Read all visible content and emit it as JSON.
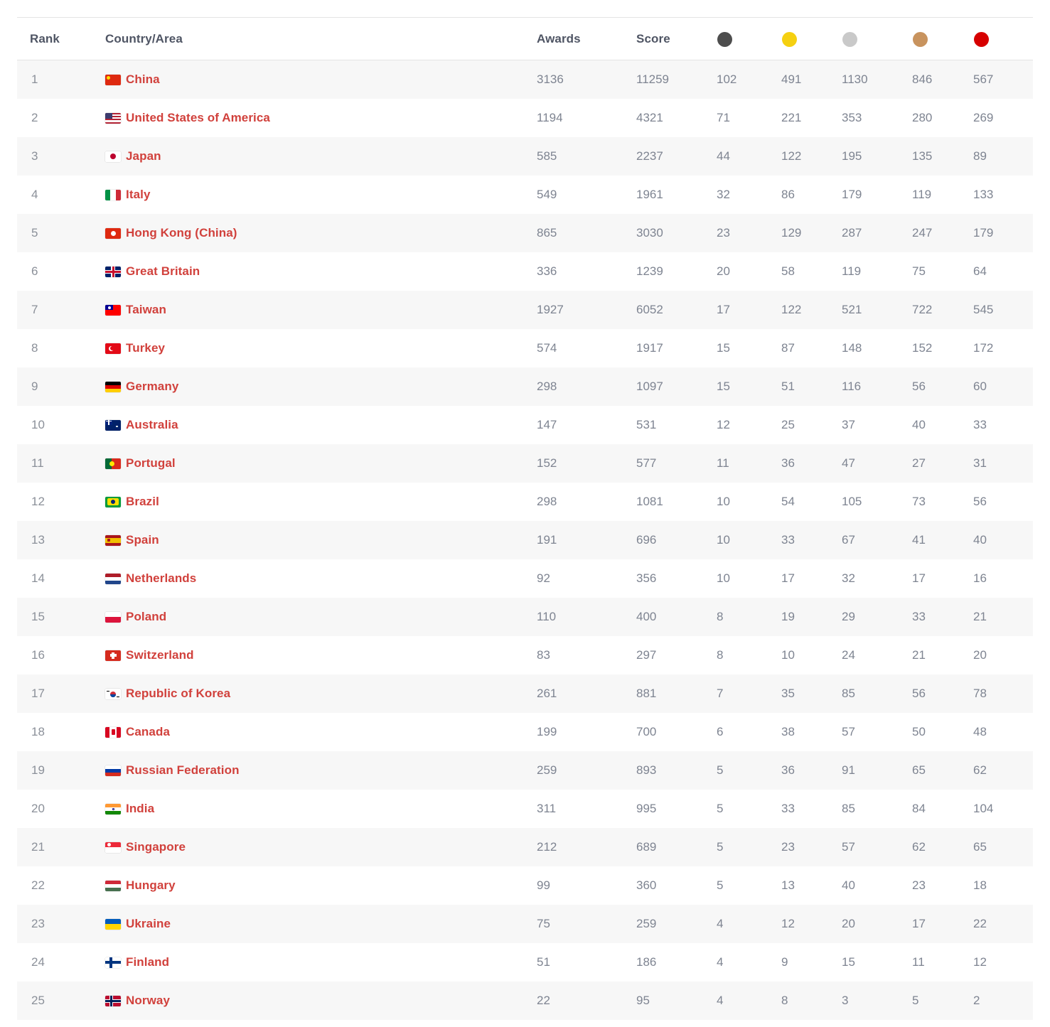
{
  "table": {
    "columns": [
      {
        "key": "rank",
        "label": "Rank",
        "type": "text"
      },
      {
        "key": "country",
        "label": "Country/Area",
        "type": "text"
      },
      {
        "key": "awards",
        "label": "Awards",
        "type": "text"
      },
      {
        "key": "score",
        "label": "Score",
        "type": "text"
      },
      {
        "key": "m1",
        "label": "",
        "type": "dot",
        "icon": "dark-medal-icon",
        "color": "#4d4d4d"
      },
      {
        "key": "m2",
        "label": "",
        "type": "dot",
        "icon": "gold-medal-icon",
        "color": "#f5d011"
      },
      {
        "key": "m3",
        "label": "",
        "type": "dot",
        "icon": "silver-medal-icon",
        "color": "#c9c9c9"
      },
      {
        "key": "m4",
        "label": "",
        "type": "dot",
        "icon": "bronze-medal-icon",
        "color": "#c8935e"
      },
      {
        "key": "m5",
        "label": "",
        "type": "dot",
        "icon": "red-medal-icon",
        "color": "#d60000"
      }
    ],
    "rows": [
      {
        "rank": "1",
        "flag": "cn",
        "country": "China",
        "awards": "3136",
        "score": "11259",
        "m1": "102",
        "m2": "491",
        "m3": "1130",
        "m4": "846",
        "m5": "567"
      },
      {
        "rank": "2",
        "flag": "us",
        "country": "United States of America",
        "awards": "1194",
        "score": "4321",
        "m1": "71",
        "m2": "221",
        "m3": "353",
        "m4": "280",
        "m5": "269"
      },
      {
        "rank": "3",
        "flag": "jp",
        "country": "Japan",
        "awards": "585",
        "score": "2237",
        "m1": "44",
        "m2": "122",
        "m3": "195",
        "m4": "135",
        "m5": "89"
      },
      {
        "rank": "4",
        "flag": "it",
        "country": "Italy",
        "awards": "549",
        "score": "1961",
        "m1": "32",
        "m2": "86",
        "m3": "179",
        "m4": "119",
        "m5": "133"
      },
      {
        "rank": "5",
        "flag": "hk",
        "country": "Hong Kong (China)",
        "awards": "865",
        "score": "3030",
        "m1": "23",
        "m2": "129",
        "m3": "287",
        "m4": "247",
        "m5": "179"
      },
      {
        "rank": "6",
        "flag": "gb",
        "country": "Great Britain",
        "awards": "336",
        "score": "1239",
        "m1": "20",
        "m2": "58",
        "m3": "119",
        "m4": "75",
        "m5": "64"
      },
      {
        "rank": "7",
        "flag": "tw",
        "country": "Taiwan",
        "awards": "1927",
        "score": "6052",
        "m1": "17",
        "m2": "122",
        "m3": "521",
        "m4": "722",
        "m5": "545"
      },
      {
        "rank": "8",
        "flag": "tr",
        "country": "Turkey",
        "awards": "574",
        "score": "1917",
        "m1": "15",
        "m2": "87",
        "m3": "148",
        "m4": "152",
        "m5": "172"
      },
      {
        "rank": "9",
        "flag": "de",
        "country": "Germany",
        "awards": "298",
        "score": "1097",
        "m1": "15",
        "m2": "51",
        "m3": "116",
        "m4": "56",
        "m5": "60"
      },
      {
        "rank": "10",
        "flag": "au",
        "country": "Australia",
        "awards": "147",
        "score": "531",
        "m1": "12",
        "m2": "25",
        "m3": "37",
        "m4": "40",
        "m5": "33"
      },
      {
        "rank": "11",
        "flag": "pt",
        "country": "Portugal",
        "awards": "152",
        "score": "577",
        "m1": "11",
        "m2": "36",
        "m3": "47",
        "m4": "27",
        "m5": "31"
      },
      {
        "rank": "12",
        "flag": "br",
        "country": "Brazil",
        "awards": "298",
        "score": "1081",
        "m1": "10",
        "m2": "54",
        "m3": "105",
        "m4": "73",
        "m5": "56"
      },
      {
        "rank": "13",
        "flag": "es",
        "country": "Spain",
        "awards": "191",
        "score": "696",
        "m1": "10",
        "m2": "33",
        "m3": "67",
        "m4": "41",
        "m5": "40"
      },
      {
        "rank": "14",
        "flag": "nl",
        "country": "Netherlands",
        "awards": "92",
        "score": "356",
        "m1": "10",
        "m2": "17",
        "m3": "32",
        "m4": "17",
        "m5": "16"
      },
      {
        "rank": "15",
        "flag": "pl",
        "country": "Poland",
        "awards": "110",
        "score": "400",
        "m1": "8",
        "m2": "19",
        "m3": "29",
        "m4": "33",
        "m5": "21"
      },
      {
        "rank": "16",
        "flag": "ch",
        "country": "Switzerland",
        "awards": "83",
        "score": "297",
        "m1": "8",
        "m2": "10",
        "m3": "24",
        "m4": "21",
        "m5": "20"
      },
      {
        "rank": "17",
        "flag": "kr",
        "country": "Republic of Korea",
        "awards": "261",
        "score": "881",
        "m1": "7",
        "m2": "35",
        "m3": "85",
        "m4": "56",
        "m5": "78"
      },
      {
        "rank": "18",
        "flag": "ca",
        "country": "Canada",
        "awards": "199",
        "score": "700",
        "m1": "6",
        "m2": "38",
        "m3": "57",
        "m4": "50",
        "m5": "48"
      },
      {
        "rank": "19",
        "flag": "ru",
        "country": "Russian Federation",
        "awards": "259",
        "score": "893",
        "m1": "5",
        "m2": "36",
        "m3": "91",
        "m4": "65",
        "m5": "62"
      },
      {
        "rank": "20",
        "flag": "in",
        "country": "India",
        "awards": "311",
        "score": "995",
        "m1": "5",
        "m2": "33",
        "m3": "85",
        "m4": "84",
        "m5": "104"
      },
      {
        "rank": "21",
        "flag": "sg",
        "country": "Singapore",
        "awards": "212",
        "score": "689",
        "m1": "5",
        "m2": "23",
        "m3": "57",
        "m4": "62",
        "m5": "65"
      },
      {
        "rank": "22",
        "flag": "hu",
        "country": "Hungary",
        "awards": "99",
        "score": "360",
        "m1": "5",
        "m2": "13",
        "m3": "40",
        "m4": "23",
        "m5": "18"
      },
      {
        "rank": "23",
        "flag": "ua",
        "country": "Ukraine",
        "awards": "75",
        "score": "259",
        "m1": "4",
        "m2": "12",
        "m3": "20",
        "m4": "17",
        "m5": "22"
      },
      {
        "rank": "24",
        "flag": "fi",
        "country": "Finland",
        "awards": "51",
        "score": "186",
        "m1": "4",
        "m2": "9",
        "m3": "15",
        "m4": "11",
        "m5": "12"
      },
      {
        "rank": "25",
        "flag": "no",
        "country": "Norway",
        "awards": "22",
        "score": "95",
        "m1": "4",
        "m2": "8",
        "m3": "3",
        "m4": "5",
        "m5": "2"
      }
    ]
  },
  "theme": {
    "country_link_color": "#d1413c",
    "header_text_color": "#4f5564",
    "value_text_color": "#7e8491",
    "row_alt_background": "#f7f7f7",
    "row_background": "#ffffff",
    "border_color": "#e4e4e4"
  }
}
